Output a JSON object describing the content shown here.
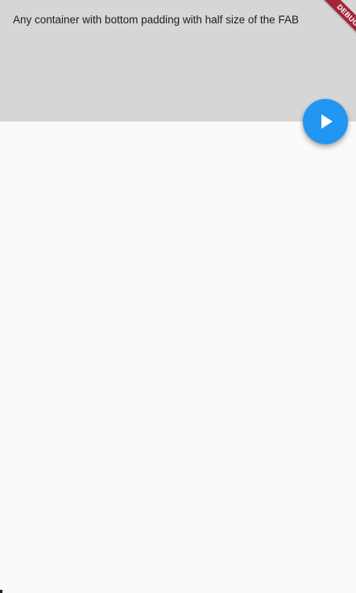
{
  "header": {
    "text": "Any container with bottom padding with half size of the FAB",
    "background": "#d6d6d6"
  },
  "fab": {
    "icon": "play-arrow-icon",
    "color": "#2196f3"
  },
  "debug_banner": {
    "label": "DEBUG",
    "color": "#a3253a"
  },
  "page": {
    "background": "#fafafa"
  }
}
